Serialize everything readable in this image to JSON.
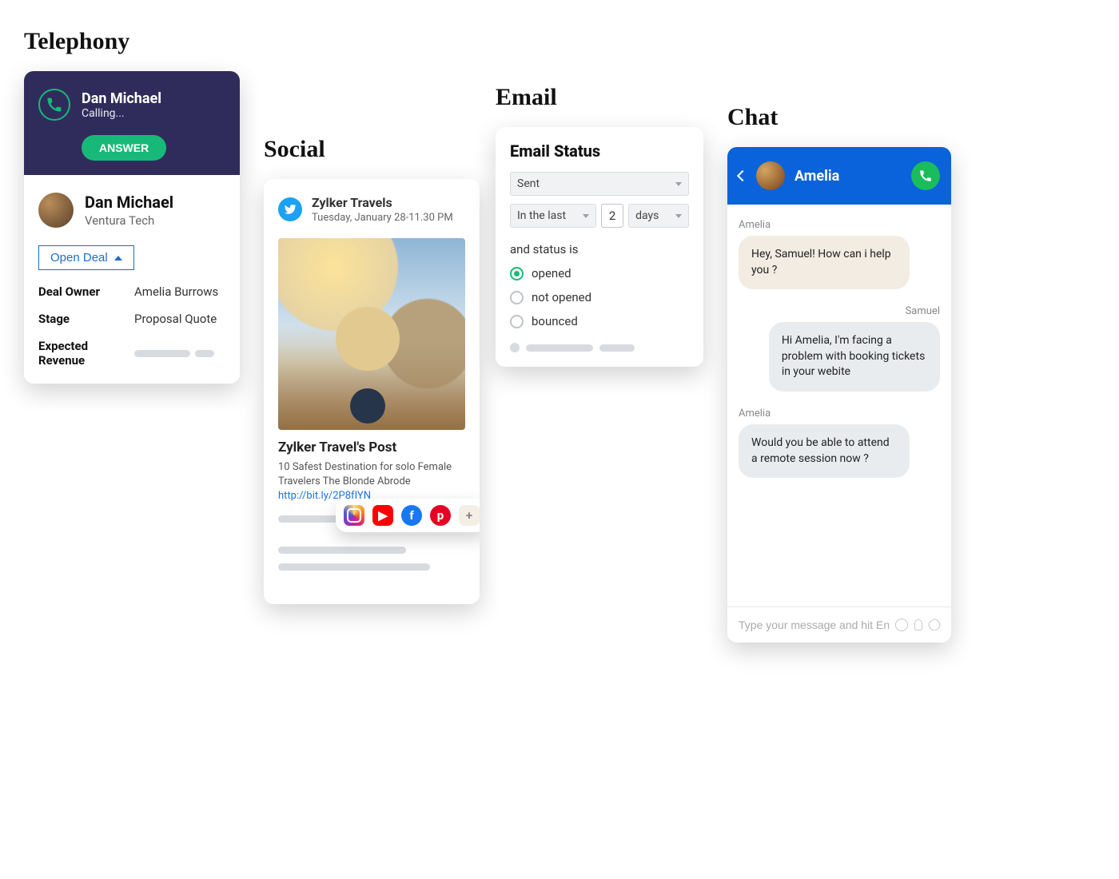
{
  "telephony": {
    "section_label": "Telephony",
    "caller_name": "Dan Michael",
    "caller_status": "Calling...",
    "answer_label": "ANSWER",
    "contact_name": "Dan Michael",
    "contact_company": "Ventura Tech",
    "open_deal_label": "Open Deal",
    "deal_owner_k": "Deal Owner",
    "deal_owner_v": "Amelia Burrows",
    "stage_k": "Stage",
    "stage_v": "Proposal Quote",
    "expected_rev_k": "Expected Revenue"
  },
  "social": {
    "section_label": "Social",
    "account_name": "Zylker Travels",
    "timestamp": "Tuesday, January 28-11.30 PM",
    "post_title": "Zylker Travel's Post",
    "post_body": "10 Safest Destination for solo Female Travelers The Blonde Abrode ",
    "post_link": "http://bit.ly/2P8fIYN"
  },
  "email": {
    "section_label": "Email",
    "title": "Email Status",
    "status_select_value": "Sent",
    "range_mode": "In the last",
    "range_value": "2",
    "range_unit": "days",
    "and_status_is": "and status is",
    "opt_opened": "opened",
    "opt_not_opened": "not opened",
    "opt_bounced": "bounced"
  },
  "chat": {
    "section_label": "Chat",
    "peer_name": "Amelia",
    "msgs": {
      "m0_sender": "Amelia",
      "m0_text": "Hey, Samuel! How can i help you ?",
      "m1_sender": "Samuel",
      "m1_text": "Hi Amelia, I'm facing a problem with booking tickets in your webite",
      "m2_sender": "Amelia",
      "m2_text": "Would you be able to attend a remote session now ?"
    },
    "input_placeholder": "Type your message and hit Enter"
  }
}
